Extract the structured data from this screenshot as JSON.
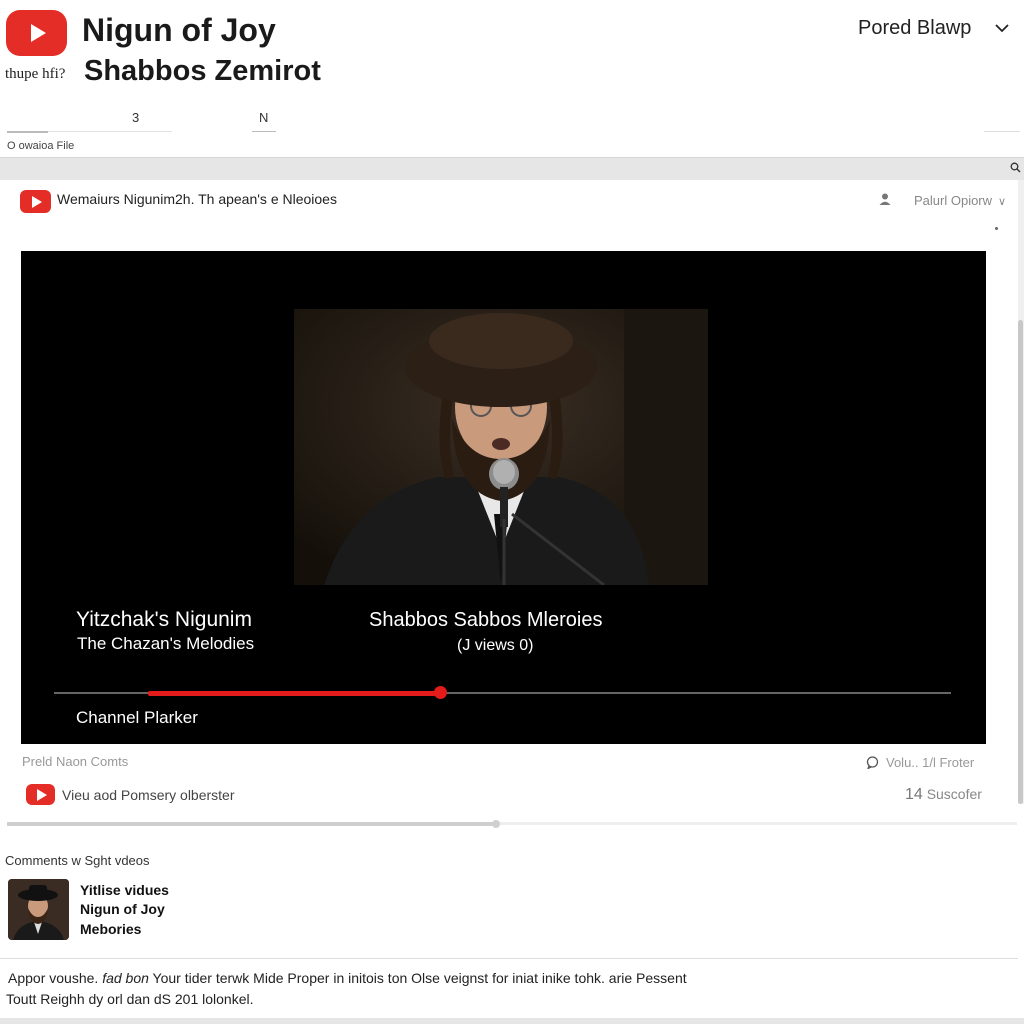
{
  "header": {
    "title_line1": "Nigun of Joy",
    "title_line2": "Shabbos Zemirot",
    "under_logo_text": "thupe hfi?",
    "account_name": "Pored Blawp",
    "logo_icon": "youtube-logo-icon",
    "brand_color": "#e52d27"
  },
  "tabs": {
    "tab1": "3",
    "tab2": "N",
    "sub_line": "O owaioa File"
  },
  "video_header": {
    "text": "Wemaiurs Nigunim2h. Th apean's e Nleoioes",
    "player_option": "Palurl Opiorw"
  },
  "player": {
    "left_line1": "Yitzchak's Nigunim",
    "left_line2": "The Chazan's Melodies",
    "center_line1": "Shabbos Sabbos Mleroies",
    "center_line2": "(J views 0)",
    "channel_label": "Channel Plarker",
    "progress": 0.33,
    "progress_color": "#e31b1b"
  },
  "below_player": {
    "left_text": "Preld Naon Comts",
    "right_text": "Volu.. 1/l Froter",
    "channel_name": "Vieu aod Pomsery olberster",
    "sub_number": "14",
    "sub_label": "Suscofer"
  },
  "comments": {
    "heading": "Comments w Sght vdeos",
    "rec_line1": "Yitlise vidues",
    "rec_line2": "Nigun of Joy",
    "rec_line3": "Mebories"
  },
  "footer": {
    "para1_start": "Appor voushe.",
    "para1_italic": "fad bon",
    "para1_rest": "Your tider terwk Mide Proper in initois ton Olse veignst for iniat inike tohk. arie Pessent",
    "para2": "Toutt Reighh dy orl dan dS 201 lolonkel."
  }
}
